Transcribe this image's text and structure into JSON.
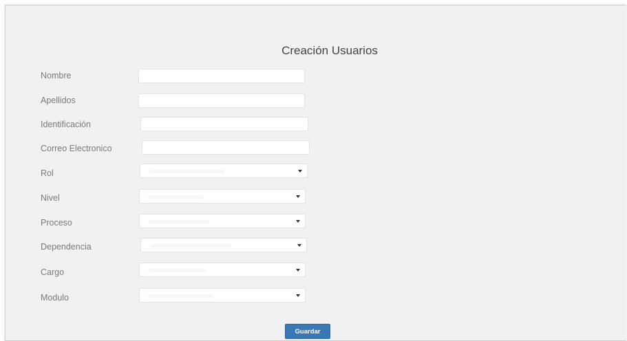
{
  "form": {
    "title": "Creación Usuarios",
    "fields": [
      {
        "label": "Nombre",
        "type": "text",
        "value": ""
      },
      {
        "label": "Apellidos",
        "type": "text",
        "value": ""
      },
      {
        "label": "Identificación",
        "type": "text",
        "value": ""
      },
      {
        "label": "Correo Electronico",
        "type": "text",
        "value": ""
      },
      {
        "label": "Rol",
        "type": "select",
        "value": ""
      },
      {
        "label": "Nivel",
        "type": "select",
        "value": ""
      },
      {
        "label": "Proceso",
        "type": "select",
        "value": ""
      },
      {
        "label": "Dependencia",
        "type": "select",
        "value": ""
      },
      {
        "label": "Cargo",
        "type": "select",
        "value": ""
      },
      {
        "label": "Modulo",
        "type": "select",
        "value": ""
      }
    ],
    "submit_label": "Guardar"
  },
  "colors": {
    "panel_background": "#f1f1f1",
    "button_primary": "#3a78b5"
  }
}
